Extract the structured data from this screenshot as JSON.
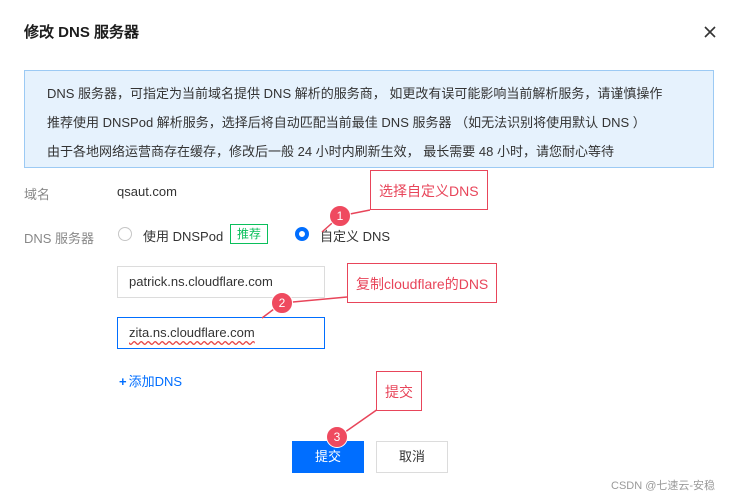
{
  "dialog": {
    "title": "修改 DNS 服务器",
    "close_icon": "close-icon"
  },
  "notice": {
    "lines": [
      "DNS 服务器，可指定为当前域名提供 DNS 解析的服务商， 如更改有误可能影响当前解析服务，请谨慎操作",
      "推荐使用 DNSPod 解析服务，选择后将自动匹配当前最佳 DNS 服务器 （如无法识别将使用默认 DNS ）",
      "由于各地网络运营商存在缓存，修改后一般 24 小时内刷新生效， 最长需要 48 小时，请您耐心等待"
    ]
  },
  "form": {
    "domain_label": "域名",
    "domain_value": "qsaut.com",
    "dns_label": "DNS 服务器",
    "option_dnspod": "使用 DNSPod",
    "option_dnspod_tag": "推荐",
    "option_custom": "自定义 DNS",
    "selected_option": "自定义 DNS",
    "dns_inputs": [
      "patrick.ns.cloudflare.com",
      "zita.ns.cloudflare.com"
    ],
    "add_dns_plus": "+",
    "add_dns": "添加DNS"
  },
  "buttons": {
    "submit": "提交",
    "cancel": "取消"
  },
  "annotations": {
    "color": "#e8455a",
    "callouts": [
      "选择自定义DNS",
      "复制cloudflare的DNS",
      "提交"
    ],
    "badges": [
      "1",
      "2",
      "3"
    ]
  },
  "colors": {
    "primary": "#006eff",
    "recommend_tag": "#0abf5b",
    "notice_bg": "#e6f2fd",
    "notice_border": "#9ccaf4"
  },
  "watermark": "CSDN @七速云-安稳"
}
